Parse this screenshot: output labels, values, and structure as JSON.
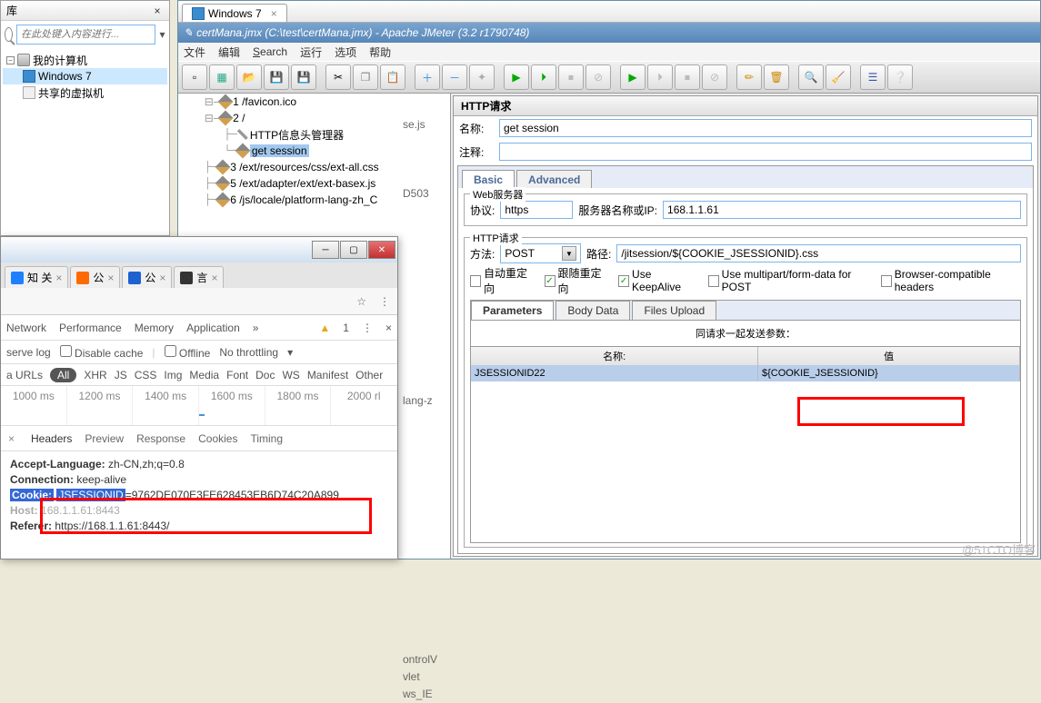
{
  "leftPane": {
    "title": "库",
    "searchPlaceholder": "在此处键入内容进行...",
    "tree": {
      "root": "我的计算机",
      "w7": "Windows 7",
      "vm": "共享的虚拟机"
    }
  },
  "jm": {
    "tab": "Windows 7",
    "title": "certMana.jmx (C:\\test\\certMana.jmx) - Apache JMeter (3.2 r1790748)",
    "menu": [
      "文件",
      "编辑",
      "Search",
      "运行",
      "选项",
      "帮助"
    ],
    "tree": [
      "1 /favicon.ico",
      "2 /",
      "HTTP信息头管理器",
      "get session",
      "3 /ext/resources/css/ext-all.css",
      "5 /ext/adapter/ext/ext-basex.js",
      "6 /js/locale/platform-lang-zh_C"
    ],
    "bgList": [
      "se.js",
      "",
      "",
      "",
      "D503",
      "",
      "",
      "",
      "",
      "",
      "",
      "",
      "",
      "",
      "",
      "",
      "",
      "",
      "lang-z",
      "",
      "",
      "",
      "",
      "",
      "",
      "",
      "",
      "",
      "",
      "",
      "",
      "",
      "",
      "ontrolV",
      "vlet",
      "ws_IE"
    ]
  },
  "detail": {
    "title": "HTTP请求",
    "nameLabel": "名称:",
    "nameValue": "get session",
    "noteLabel": "注释:",
    "tabs": {
      "basic": "Basic",
      "adv": "Advanced"
    },
    "web": {
      "group": "Web服务器",
      "protoLabel": "协议:",
      "protoValue": "https",
      "ipLabel": "服务器名称或IP:",
      "ipValue": "168.1.1.61"
    },
    "http": {
      "group": "HTTP请求",
      "methodLabel": "方法:",
      "methodValue": "POST",
      "pathLabel": "路径:",
      "pathValue": "/jitsession/${COOKIE_JSESSIONID}.css",
      "cb1": "自动重定向",
      "cb2": "跟随重定向",
      "cb3": "Use KeepAlive",
      "cb4": "Use multipart/form-data for POST",
      "cb5": "Browser-compatible headers"
    },
    "reqTabs": {
      "p": "Parameters",
      "b": "Body Data",
      "f": "Files Upload"
    },
    "paramsTitle": "同请求一起发送参数：",
    "cols": {
      "name": "名称:",
      "val": "值"
    },
    "row": {
      "name": "JSESSIONID22",
      "val": "${COOKIE_JSESSIONID}"
    }
  },
  "dev": {
    "tabs": [
      {
        "label": "知 关",
        "color": "#1e80ff"
      },
      {
        "label": "公",
        "color": "#ff6a00"
      },
      {
        "label": "公",
        "color": "#1e62d0"
      },
      {
        "label": "言",
        "color": "#333"
      }
    ],
    "tb": [
      "Network",
      "Performance",
      "Memory",
      "Application"
    ],
    "warnCount": "1",
    "sub": {
      "serve": "serve log",
      "dc": "Disable cache",
      "off": "Offline",
      "nt": "No throttling"
    },
    "filters": [
      "a URLs",
      "All",
      "XHR",
      "JS",
      "CSS",
      "Img",
      "Media",
      "Font",
      "Doc",
      "WS",
      "Manifest",
      "Other"
    ],
    "times": [
      "1000 ms",
      "1200 ms",
      "1400 ms",
      "1600 ms",
      "1800 ms",
      "2000 rl"
    ],
    "dtabs": [
      "Headers",
      "Preview",
      "Response",
      "Cookies",
      "Timing"
    ],
    "hdr": {
      "al": "Accept-Language:",
      "alv": "zh-CN,zh;q=0.8",
      "cn": "Connection:",
      "cnv": "keep-alive",
      "ck": "Cookie:",
      "ckk": "JSESSIONID",
      "ckv": "=9762DE070E3FE628453EB6D74C20A899",
      "hs": "Host:",
      "hsv": "168.1.1.61:8443",
      "rf": "Referer:",
      "rfv": "https://168.1.1.61:8443/"
    }
  },
  "watermark": "@51CTO博客"
}
